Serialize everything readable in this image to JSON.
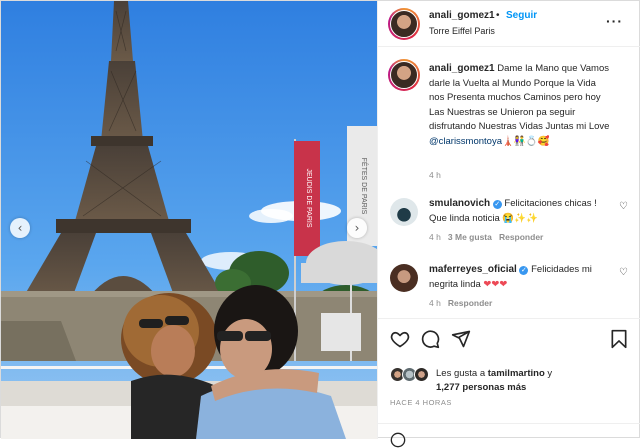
{
  "post": {
    "username": "anali_gomez1",
    "follow_label": "Seguir",
    "dot": "•",
    "location": "Torre Eiffel Paris",
    "caption_user": "anali_gomez1",
    "caption": "Dame la Mano que Vamos darle la Vuelta al Mundo Porque la Vida nos Presenta muchos Caminos pero hoy Las Nuestras se Unieron pa seguir disfrutando Nuestras Vidas Juntas mi Love",
    "caption_mention": "@clarissmontoya",
    "caption_emojis": "🗼👫💍🥰",
    "caption_time": "4 h"
  },
  "photo": {
    "banner_text": "JEUDIS DE PARIS",
    "banner2_text": "FÊTES DE PARIS"
  },
  "comments": [
    {
      "user": "smulanovich",
      "text": "Felicitaciones chicas ! Que linda noticia",
      "emojis": "😭✨✨",
      "time": "4 h",
      "likes": "3 Me gusta",
      "reply": "Responder"
    },
    {
      "user": "maferreyes_oficial",
      "text": "Felicidades mi negrita linda",
      "emojis": "❤❤❤",
      "time": "4 h",
      "reply": "Responder"
    }
  ],
  "likes": {
    "prefix": "Les gusta a",
    "first_user": "tamilmartino",
    "joiner": "y",
    "others": "1,277 personas más"
  },
  "timestamp": "HACE 4 HORAS",
  "icons": {
    "prev": "chevron-left-icon",
    "next": "chevron-right-icon",
    "more": "more-horizontal-icon",
    "like": "heart-icon",
    "comment": "comment-icon",
    "share": "share-icon",
    "save": "bookmark-icon",
    "verified": "verified-badge-icon"
  },
  "colors": {
    "accent": "#0095f6",
    "text": "#262626",
    "muted": "#8e8e8e",
    "verified": "#3897f0",
    "heart": "#ed4956"
  }
}
